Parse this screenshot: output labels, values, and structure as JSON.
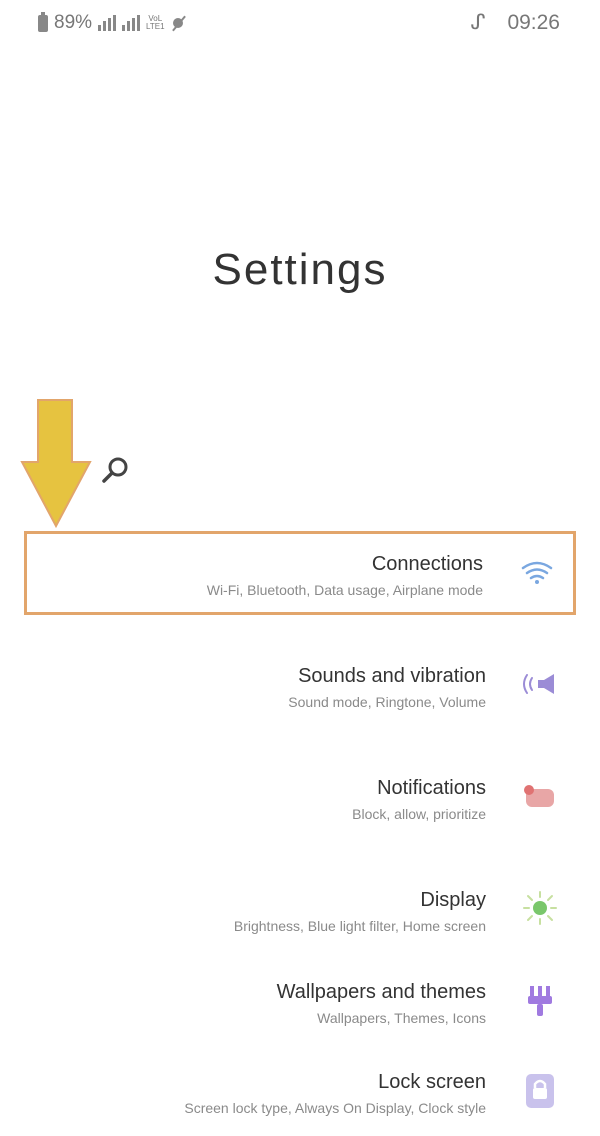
{
  "status_bar": {
    "battery_percent": "89%",
    "network": "LTE1",
    "time": "09:26",
    "time_suffix": "ᔑ"
  },
  "page": {
    "title": "Settings"
  },
  "search": {
    "icon": "search-icon"
  },
  "settings_items": [
    {
      "title": "Connections",
      "subtitle": "Wi-Fi, Bluetooth, Data usage, Airplane mode",
      "icon": "wifi-icon",
      "color": "#7aa7e0"
    },
    {
      "title": "Sounds and vibration",
      "subtitle": "Sound mode, Ringtone, Volume",
      "icon": "speaker-icon",
      "color": "#9b8cd6"
    },
    {
      "title": "Notifications",
      "subtitle": "Block, allow, prioritize",
      "icon": "notification-icon",
      "color": "#e58b8b"
    },
    {
      "title": "Display",
      "subtitle": "Brightness, Blue light filter, Home screen",
      "icon": "sun-icon",
      "color": "#7ac76b"
    },
    {
      "title": "Wallpapers and themes",
      "subtitle": "Wallpapers, Themes, Icons",
      "icon": "brush-icon",
      "color": "#a07ae0"
    },
    {
      "title": "Lock screen",
      "subtitle": "Screen lock type, Always On Display, Clock style",
      "icon": "lock-icon",
      "color": "#a59ad6"
    }
  ],
  "colors": {
    "highlight_border": "#e2a56b",
    "arrow_fill": "#e6c340",
    "arrow_stroke": "#e2a56b"
  }
}
